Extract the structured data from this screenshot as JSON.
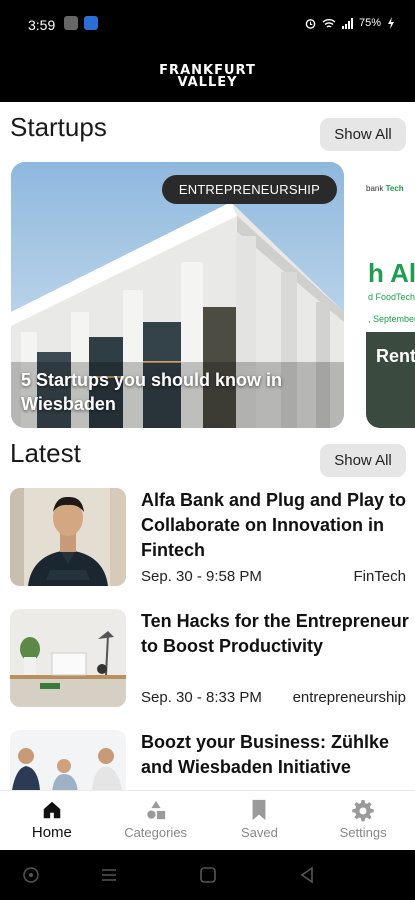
{
  "status_bar": {
    "time": "3:59",
    "battery": "75%",
    "icons": [
      "gallery-icon",
      "bluetooth-icon",
      "alarm-icon",
      "wifi-icon",
      "signal-icon",
      "battery-icon"
    ]
  },
  "header": {
    "logo_line1": "FRANKFURT",
    "logo_line2": "VALLEY"
  },
  "startups": {
    "title": "Startups",
    "show_all": "Show All",
    "cards": [
      {
        "badge": "ENTREPRENEURSHIP",
        "caption": "5 Startups you should know in Wiesbaden"
      },
      {
        "brand_left": "bank",
        "brand_right": "Tech",
        "headline": "h All",
        "sub": "d FoodTech",
        "date": ", September",
        "caption": "Rent launc on A"
      }
    ]
  },
  "latest": {
    "title": "Latest",
    "show_all": "Show All",
    "articles": [
      {
        "title": "Alfa Bank and Plug and Play to Collaborate on Innovation in Fintech",
        "date": "Sep. 30 - 9:58 PM",
        "category": "FinTech"
      },
      {
        "title": "Ten Hacks for the Entrepreneur to Boost Productivity",
        "date": "Sep. 30 - 8:33 PM",
        "category": "entrepreneurship"
      },
      {
        "title": "Boozt your Business: Zühlke and Wiesbaden Initiative",
        "date": "",
        "category": ""
      }
    ]
  },
  "tabs": [
    {
      "label": "Home",
      "icon": "home-icon",
      "active": true
    },
    {
      "label": "Categories",
      "icon": "categories-icon",
      "active": false
    },
    {
      "label": "Saved",
      "icon": "bookmark-icon",
      "active": false
    },
    {
      "label": "Settings",
      "icon": "gear-icon",
      "active": false
    }
  ],
  "colors": {
    "accent_green": "#1e9e4e",
    "badge_bg": "#2a2a2a",
    "show_all_bg": "#e6e6e6"
  }
}
